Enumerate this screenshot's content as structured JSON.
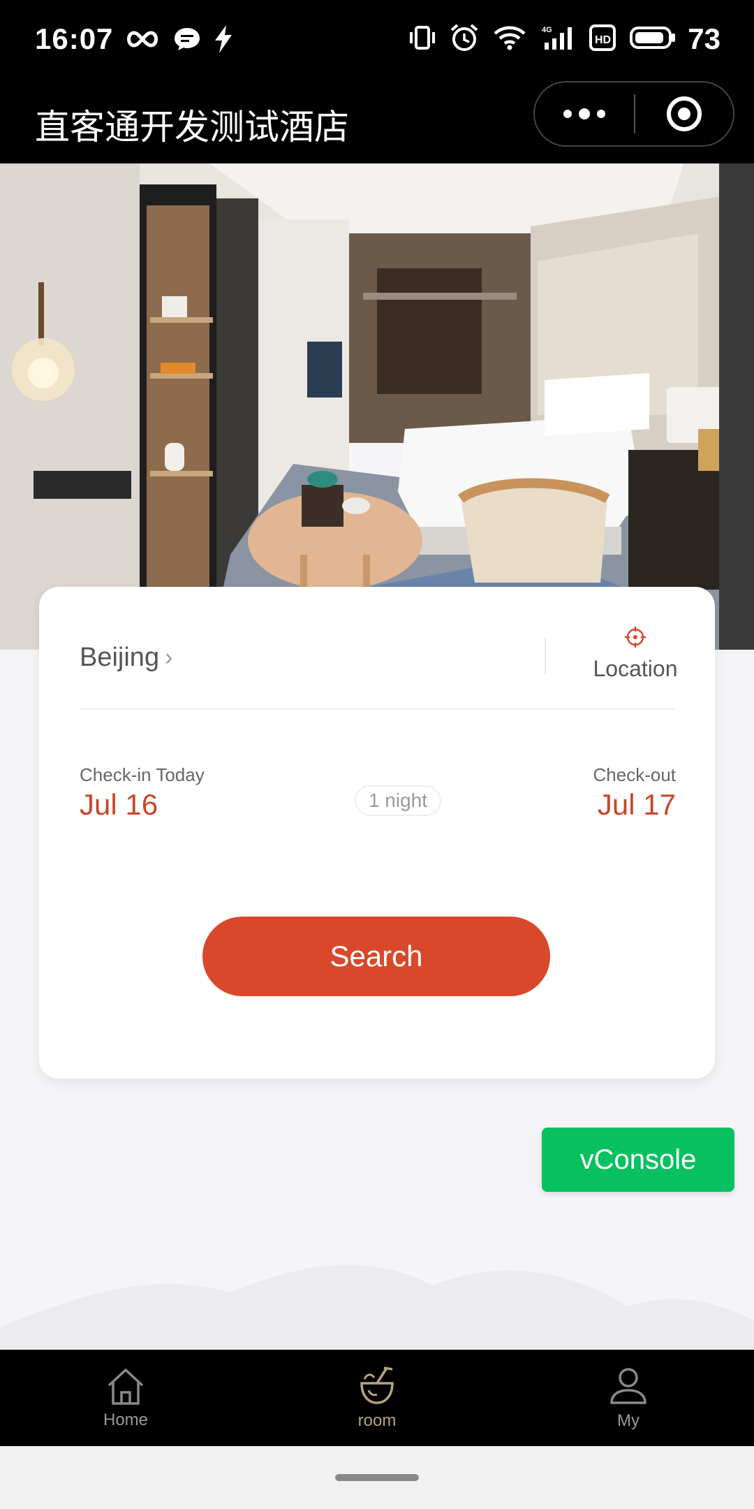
{
  "status_bar": {
    "time": "16:07",
    "battery": "73"
  },
  "nav": {
    "title": "直客通开发测试酒店"
  },
  "search_card": {
    "city": "Beijing",
    "location_label": "Location",
    "checkin_label": "Check-in Today",
    "checkin_date": "Jul 16",
    "nights": "1 night",
    "checkout_label": "Check-out",
    "checkout_date": "Jul 17",
    "search_label": "Search"
  },
  "vconsole_label": "vConsole",
  "tabbar": {
    "items": [
      {
        "label": "Home",
        "icon": "home-icon"
      },
      {
        "label": "room",
        "icon": "coconut-drink-icon"
      },
      {
        "label": "My",
        "icon": "user-icon"
      }
    ]
  },
  "colors": {
    "accent": "#d9482b",
    "date": "#c9462b",
    "vconsole": "#07c160"
  }
}
